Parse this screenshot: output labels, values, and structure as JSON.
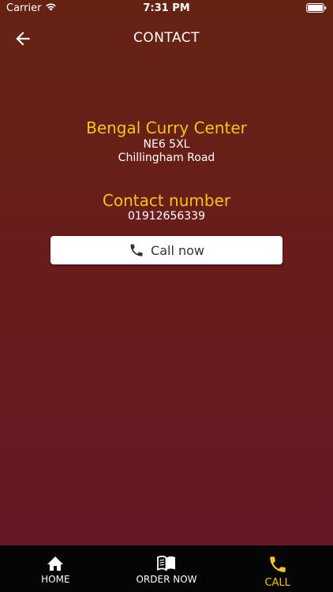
{
  "status_bar": {
    "carrier": "Carrier",
    "time": "7:31 PM"
  },
  "nav": {
    "title": "CONTACT",
    "back_icon": "arrow-left-icon"
  },
  "restaurant": {
    "name": "Bengal Curry Center",
    "postcode": "NE6 5XL",
    "street": "Chillingham Road"
  },
  "contact": {
    "label": "Contact number",
    "phone": "01912656339",
    "call_button": "Call now"
  },
  "tabs": [
    {
      "label": "HOME",
      "icon": "home-icon",
      "active": false
    },
    {
      "label": "ORDER NOW",
      "icon": "menu-book-icon",
      "active": false
    },
    {
      "label": "CALL",
      "icon": "phone-icon",
      "active": true
    }
  ],
  "colors": {
    "accent": "#f5c518",
    "bg_top": "#652313",
    "bg_bottom": "#661626",
    "tab_bar": "#050505"
  }
}
